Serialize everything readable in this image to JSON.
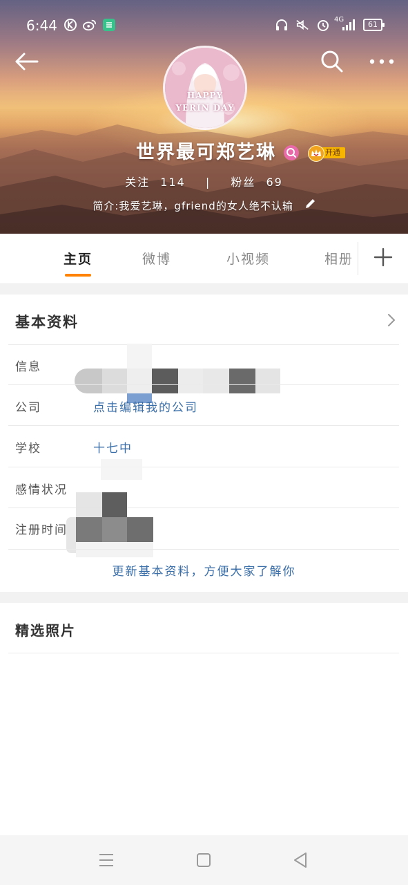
{
  "status_bar": {
    "time": "6:44",
    "network": "4G",
    "battery": "61"
  },
  "profile": {
    "name": "世界最可郑艺琳",
    "vip_label": "开通",
    "avatar_text_line1": "HAPPY",
    "avatar_text_line2": "YERIN DAY",
    "follow_label": "关注",
    "follow_count": "114",
    "fans_label": "粉丝",
    "fans_count": "69",
    "bio": "简介:我爱艺琳，gfriend的女人绝不认输"
  },
  "tabs": [
    {
      "label": "主页",
      "active": true
    },
    {
      "label": "微博",
      "active": false
    },
    {
      "label": "小视频",
      "active": false
    },
    {
      "label": "相册",
      "active": false
    }
  ],
  "basic_info": {
    "title": "基本资料",
    "rows": [
      {
        "label": "信息",
        "value": ""
      },
      {
        "label": "公司",
        "value": "点击编辑我的公司"
      },
      {
        "label": "学校",
        "value": "十七中"
      },
      {
        "label": "感情状况",
        "value": ""
      },
      {
        "label": "注册时间",
        "value": ""
      }
    ],
    "update_link": "更新基本资料，方便大家了解你"
  },
  "photos": {
    "title": "精选照片"
  },
  "colors": {
    "accent": "#ff8200",
    "link": "#3a6ea8",
    "vip": "#f7b500"
  },
  "icons": {
    "back": "arrow-left-icon",
    "search": "search-icon",
    "more": "more-dots-icon",
    "edit": "pencil-icon",
    "add": "plus-icon",
    "chevron": "chevron-right-icon"
  }
}
